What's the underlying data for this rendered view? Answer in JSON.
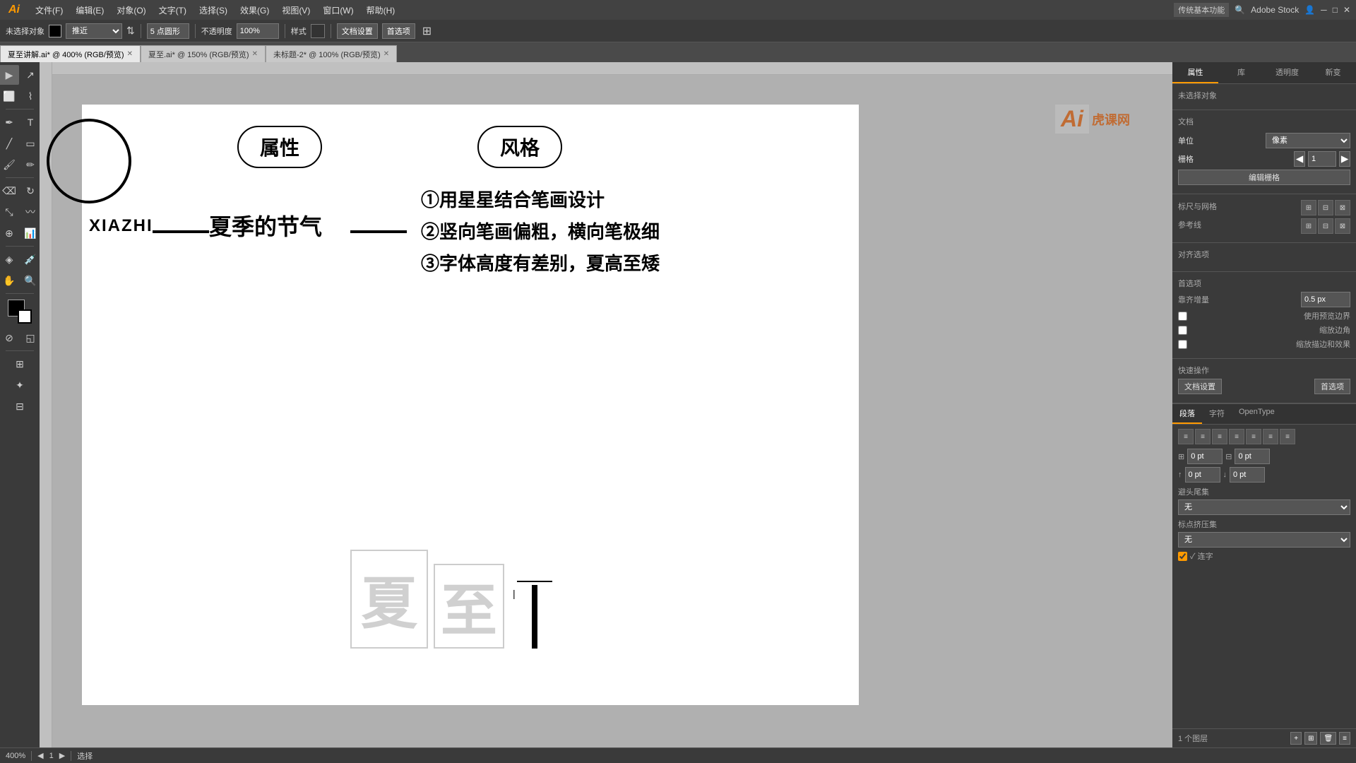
{
  "app": {
    "title": "Adobe Illustrator",
    "logo": "Ai",
    "mode": "传统基本功能"
  },
  "menubar": {
    "items": [
      "文件(F)",
      "编辑(E)",
      "对象(O)",
      "文字(T)",
      "选择(S)",
      "效果(G)",
      "视图(V)",
      "窗口(W)",
      "帮助(H)"
    ]
  },
  "toolbar": {
    "selection_label": "未选择对象",
    "color_box": "#000000",
    "nudge_label": "推近",
    "nudge_value": "",
    "point_type": "5 点圆形",
    "opacity_label": "不透明度",
    "opacity_value": "100%",
    "style_label": "样式",
    "doc_settings_btn": "文档设置",
    "preferences_btn": "首选项"
  },
  "tabs": [
    {
      "label": "夏至讲解.ai* @ 400% (RGB/预览)",
      "active": true
    },
    {
      "label": "夏至.ai* @ 150% (RGB/预览)",
      "active": false
    },
    {
      "label": "未标题-2* @ 100% (RGB/预览)",
      "active": false
    }
  ],
  "artboard": {
    "shapes": {
      "circle_partial": true,
      "pill_attr": "属性",
      "pill_style": "风格",
      "xiazhi_text": "XIAZHI",
      "season_text": "夏季的节气",
      "bullet1": "①用星星结合笔画设计",
      "bullet2": "②竖向笔画偏粗，横向笔极细",
      "bullet3": "③字体高度有差别，夏高至矮"
    },
    "char_preview": {
      "char1": "夏",
      "char2": "至",
      "cursor": "|"
    }
  },
  "right_panel": {
    "tabs": [
      "属性",
      "库",
      "透明度",
      "新变"
    ],
    "active_tab": "属性",
    "no_selection": "未选择对象",
    "document_label": "文档",
    "unit_label": "单位",
    "unit_value": "像素",
    "grid_label": "栅格",
    "grid_value": "1",
    "edit_grid_btn": "编辑栅格",
    "rulers_label": "标尺与网格",
    "guides_label": "参考线",
    "align_label": "对齐选项",
    "quick_actions_label": "快速操作",
    "doc_settings_btn2": "文档设置",
    "preferences_btn2": "首选项"
  },
  "bottom_panel": {
    "tabs": [
      "段落",
      "字符",
      "OpenType"
    ],
    "active_tab": "段落",
    "align_icons": [
      "align-left",
      "align-center",
      "align-right",
      "justify-left",
      "justify-center",
      "justify-right",
      "justify-all"
    ],
    "left_indent_label": "⊞",
    "left_indent_value": "0 pt",
    "right_indent_label": "⊟",
    "right_indent_value": "0 pt",
    "space_before_label": "↕",
    "space_before_value": "0 pt",
    "space_after_label": "↕",
    "space_after_value": "0 pt",
    "hyphen_label": "避头尾集",
    "hyphen_value": "无",
    "justify_label": "标点挤压集",
    "justify_value": "无",
    "ligature_label": "✓ 连字"
  },
  "status_bar": {
    "zoom": "400%",
    "artboard_nav": "1",
    "artboard_total": "1",
    "tool_name": "选择",
    "cursor_info": ""
  },
  "watermark": {
    "logo": "Ai",
    "subtitle": "虎课网"
  }
}
